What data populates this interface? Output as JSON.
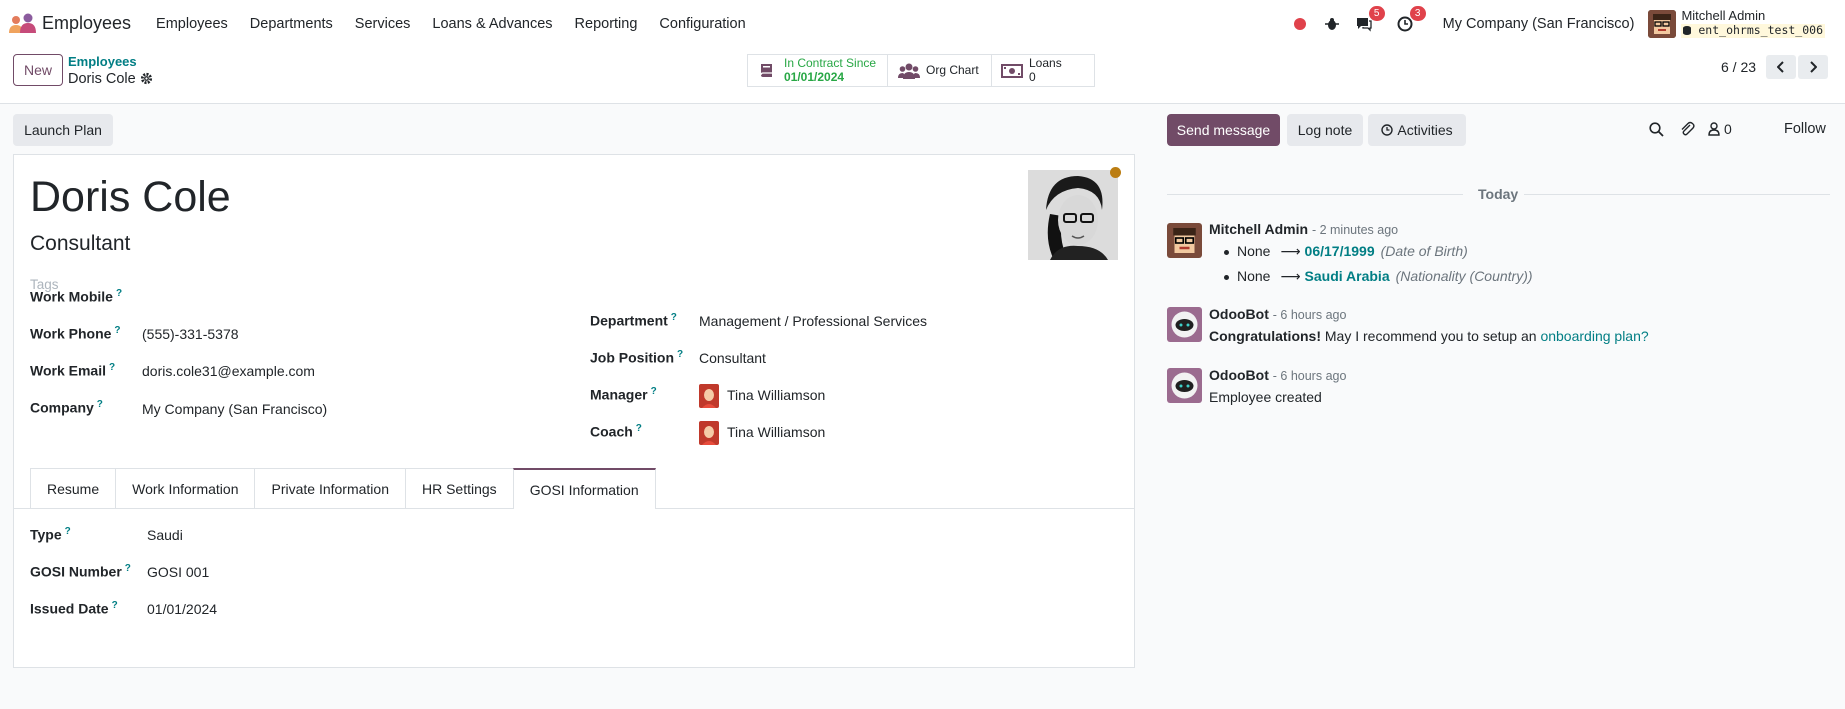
{
  "navbar": {
    "app_name": "Employees",
    "menu": [
      "Employees",
      "Departments",
      "Services",
      "Loans & Advances",
      "Reporting",
      "Configuration"
    ],
    "messages_count": "5",
    "activities_count": "3",
    "company": "My Company (San Francisco)",
    "user_name": "Mitchell Admin",
    "db_name": "ent_ohrms_test_006"
  },
  "control": {
    "new_label": "New",
    "breadcrumb_parent": "Employees",
    "breadcrumb_current": "Doris Cole",
    "smart_buttons": {
      "contract_label": "In Contract Since",
      "contract_value": "01/01/2024",
      "org_chart": "Org Chart",
      "loans_label": "Loans",
      "loans_value": "0"
    },
    "pager": "6 / 23"
  },
  "form": {
    "launch_plan": "Launch Plan",
    "name": "Doris Cole",
    "job_title": "Consultant",
    "tags_placeholder": "Tags",
    "left_fields": [
      {
        "label": "Work Mobile",
        "value": ""
      },
      {
        "label": "Work Phone",
        "value": "(555)-331-5378"
      },
      {
        "label": "Work Email",
        "value": "doris.cole31@example.com"
      },
      {
        "label": "Company",
        "value": "My Company (San Francisco)"
      }
    ],
    "right_fields": [
      {
        "label": "Department",
        "value": "Management / Professional Services"
      },
      {
        "label": "Job Position",
        "value": "Consultant"
      },
      {
        "label": "Manager",
        "value": "Tina Williamson"
      },
      {
        "label": "Coach",
        "value": "Tina Williamson"
      }
    ],
    "tabs": [
      "Resume",
      "Work Information",
      "Private Information",
      "HR Settings",
      "GOSI Information"
    ],
    "active_tab": "GOSI Information",
    "gosi_fields": [
      {
        "label": "Type",
        "value": "Saudi"
      },
      {
        "label": "GOSI Number",
        "value": "GOSI 001"
      },
      {
        "label": "Issued Date",
        "value": "01/01/2024"
      }
    ],
    "help_mark": "?"
  },
  "chatter": {
    "send_message": "Send message",
    "log_note": "Log note",
    "activities": "Activities",
    "followers_count": "0",
    "follow": "Follow",
    "today": "Today",
    "messages": [
      {
        "author": "Mitchell Admin",
        "time": "- 2 minutes ago",
        "tracking": [
          {
            "old": "None",
            "new": "06/17/1999",
            "field": "(Date of Birth)"
          },
          {
            "old": "None",
            "new": "Saudi Arabia",
            "field": "(Nationality (Country))"
          }
        ]
      },
      {
        "author": "OdooBot",
        "time": "- 6 hours ago",
        "body_bold": "Congratulations!",
        "body_text": " May I recommend you to setup an ",
        "body_link": "onboarding plan?"
      },
      {
        "author": "OdooBot",
        "time": "- 6 hours ago",
        "body_text": "Employee created"
      }
    ]
  },
  "colors": {
    "brand": "#714b67",
    "link": "#017e84",
    "success": "#28a745",
    "badge": "#e0424b"
  }
}
